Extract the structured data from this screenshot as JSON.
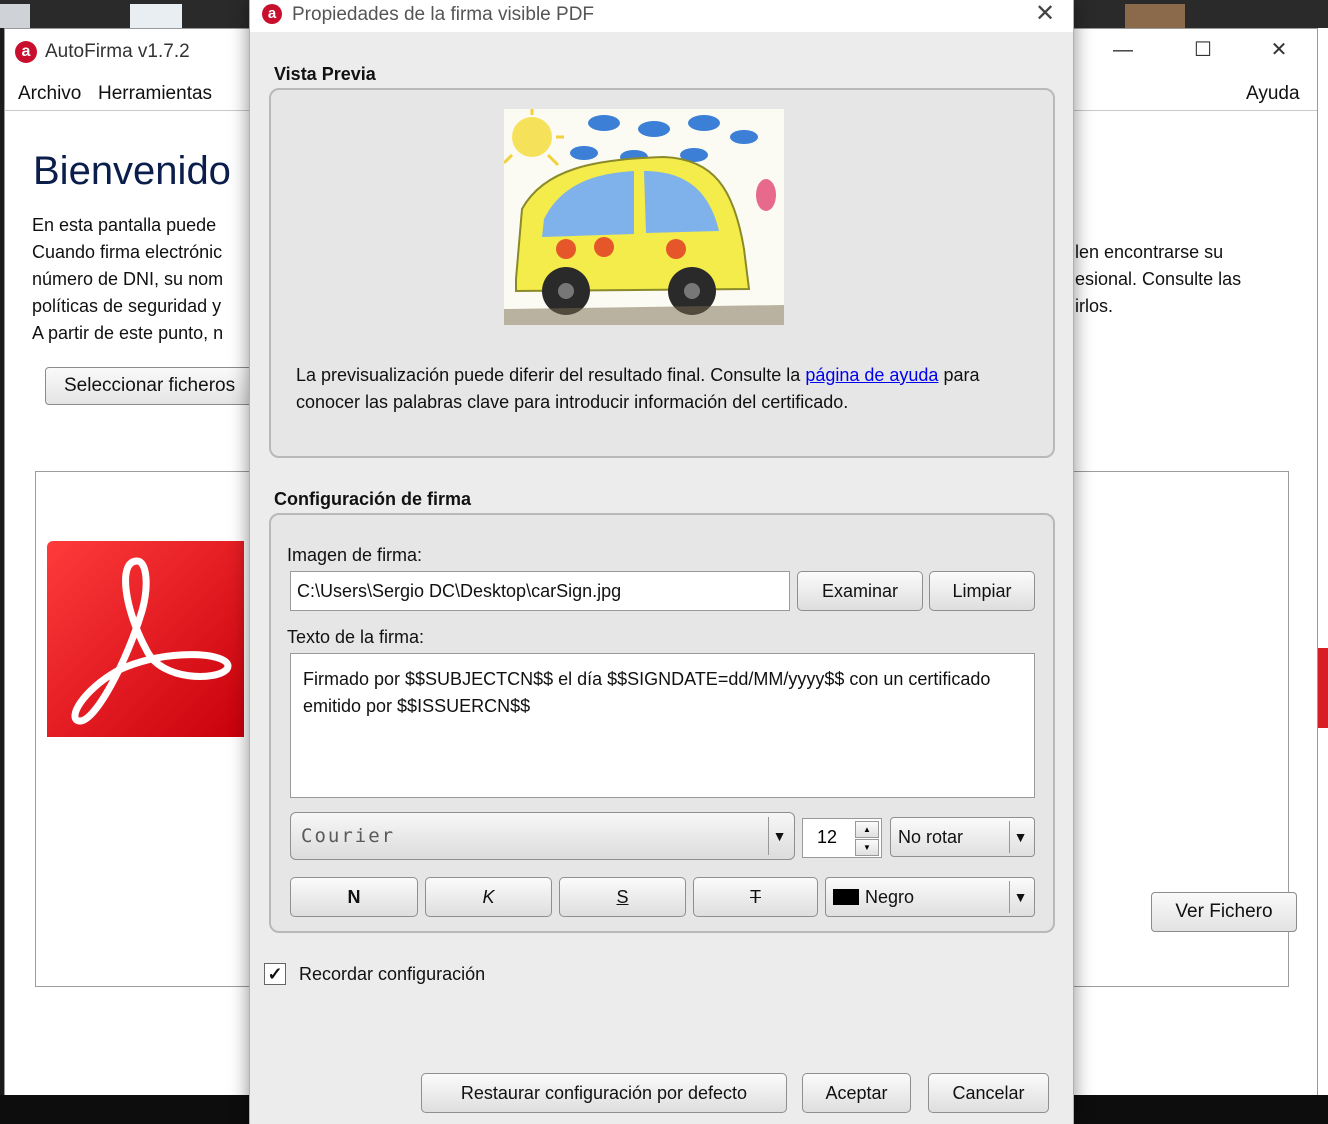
{
  "main_window": {
    "title": "AutoFirma v1.7.2",
    "controls": {
      "minimize": "—",
      "maximize": "☐",
      "close": "✕"
    },
    "menu": {
      "archivo": "Archivo",
      "herramientas": "Herramientas",
      "ayuda": "Ayuda"
    },
    "welcome_title": "Bienvenido",
    "paragraph_left": [
      "En esta pantalla puede",
      "Cuando firma electrónic",
      "número de DNI, su nom",
      "políticas de seguridad y",
      "A partir de este punto, n"
    ],
    "paragraph_right": [
      "len encontrarse su",
      "esional. Consulte las",
      "irlos."
    ],
    "select_files_button": "Seleccionar ficheros",
    "view_file_button": "Ver Fichero"
  },
  "dialog": {
    "title": "Propiedades de la firma visible PDF",
    "close": "✕",
    "preview_section": "Vista Previa",
    "preview_text_before": "La previsualización puede diferir del resultado final. Consulte la ",
    "preview_link": "página de ayuda",
    "preview_text_after": " para conocer las palabras clave para introducir información del certificado.",
    "config_section": "Configuración de firma",
    "image_label": "Imagen de firma:",
    "image_path": "C:\\Users\\Sergio DC\\Desktop\\carSign.jpg",
    "browse_button": "Examinar",
    "clear_button": "Limpiar",
    "text_label": "Texto de la firma:",
    "signature_text": "Firmado por $$SUBJECTCN$$ el día $$SIGNDATE=dd/MM/yyyy$$ con un certificado emitido por $$ISSUERCN$$",
    "font": "Courier",
    "font_size": "12",
    "rotation": "No rotar",
    "bold": "N",
    "italic": "K",
    "underline": "S",
    "strike": "T",
    "color": "Negro",
    "color_hex": "#000000",
    "remember_label": "Recordar configuración",
    "remember_checked": true,
    "restore_button": "Restaurar configuración por defecto",
    "accept_button": "Aceptar",
    "cancel_button": "Cancelar"
  }
}
